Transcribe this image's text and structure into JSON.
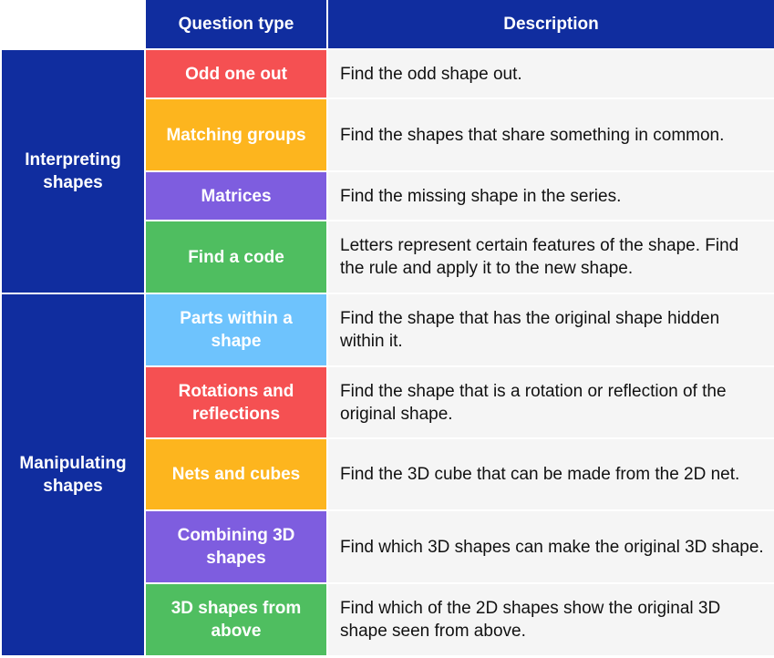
{
  "header": {
    "question_type": "Question type",
    "description": "Description"
  },
  "categories": [
    {
      "label": "Interpreting shapes"
    },
    {
      "label": "Manipulating shapes"
    }
  ],
  "rows": [
    {
      "type": "Odd one out",
      "color": "#f55052",
      "description": "Find the odd shape out."
    },
    {
      "type": "Matching groups",
      "color": "#fdb51e",
      "description": "Find the shapes that share something in common."
    },
    {
      "type": "Matrices",
      "color": "#7e5ddf",
      "description": "Find the missing shape in the series."
    },
    {
      "type": "Find a code",
      "color": "#4fbe60",
      "description": "Letters represent certain features of the shape. Find the rule and apply it to the new shape."
    },
    {
      "type": "Parts within a shape",
      "color": "#6ec3fd",
      "description": "Find the shape that has the original shape hidden within it."
    },
    {
      "type": "Rotations and reflections",
      "color": "#f55052",
      "description": "Find the shape that is a rotation or reflection of the original shape."
    },
    {
      "type": "Nets and cubes",
      "color": "#fdb51e",
      "description": "Find the 3D cube that can be made from the 2D net."
    },
    {
      "type": "Combining 3D shapes",
      "color": "#7e5ddf",
      "description": "Find which 3D shapes can make the original 3D shape."
    },
    {
      "type": "3D shapes from above",
      "color": "#4fbe60",
      "description": "Find which of the 2D shapes show the original 3D shape seen from above."
    }
  ]
}
